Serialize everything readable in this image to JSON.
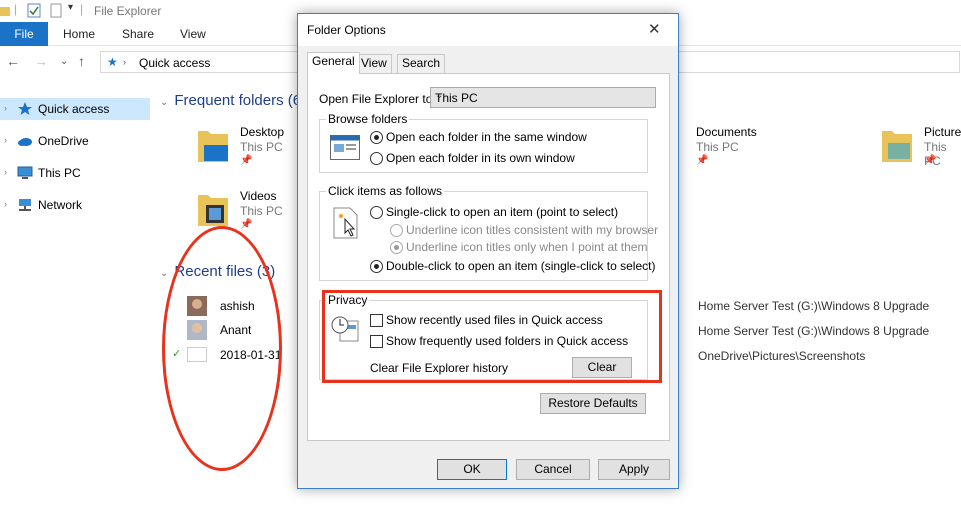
{
  "explorer": {
    "window_title": "File Explorer",
    "ribbon_tabs": [
      "File",
      "Home",
      "Share",
      "View"
    ],
    "address": "Quick access",
    "nav_items": [
      "Quick access",
      "OneDrive",
      "This PC",
      "Network"
    ],
    "frequent_header": "Frequent folders (6",
    "recent_header": "Recent files (3)",
    "frequent": [
      {
        "name": "Desktop",
        "loc": "This PC"
      },
      {
        "name": "Videos",
        "loc": "This PC"
      },
      {
        "name": "Documents",
        "loc": "This PC"
      },
      {
        "name": "Picture",
        "loc": "This PC"
      }
    ],
    "recent": [
      {
        "name": "ashish",
        "path": "Home Server Test (G:)\\Windows 8 Upgrade"
      },
      {
        "name": "Anant",
        "path": "Home Server Test (G:)\\Windows 8 Upgrade"
      },
      {
        "name": "2018-01-31",
        "path": "OneDrive\\Pictures\\Screenshots"
      }
    ]
  },
  "dialog": {
    "title": "Folder Options",
    "close": "✕",
    "tabs": [
      "General",
      "View",
      "Search"
    ],
    "open_label": "Open File Explorer to:",
    "open_value": "This PC",
    "browse": {
      "label": "Browse folders",
      "opt1": "Open each folder in the same window",
      "opt2": "Open each folder in its own window",
      "selected": 0
    },
    "click": {
      "label": "Click items as follows",
      "opt1": "Single-click to open an item (point to select)",
      "sub1": "Underline icon titles consistent with my browser",
      "sub2": "Underline icon titles only when I point at them",
      "opt2": "Double-click to open an item (single-click to select)",
      "selected": 1
    },
    "privacy": {
      "label": "Privacy",
      "chk1": "Show recently used files in Quick access",
      "chk2": "Show frequently used folders in Quick access",
      "history_label": "Clear File Explorer history",
      "clear_btn": "Clear"
    },
    "restore_btn": "Restore Defaults",
    "ok": "OK",
    "cancel": "Cancel",
    "apply": "Apply"
  },
  "colors": {
    "accent": "#1a73c6",
    "annotation": "#e8321c",
    "section_header": "#1e3f8c"
  }
}
